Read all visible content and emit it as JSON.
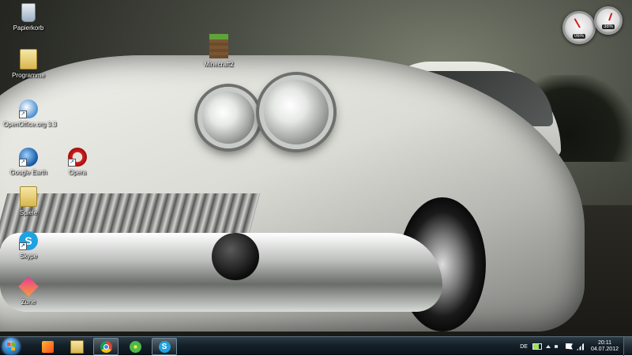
{
  "desktop": {
    "icons": [
      {
        "label": "Papierkorb",
        "icon": "recycle-bin-icon"
      },
      {
        "label": "Programme",
        "icon": "folder-icon"
      },
      {
        "label": "OpenOffice.org 3.3",
        "icon": "openoffice-icon"
      },
      {
        "label": "Google Earth",
        "icon": "google-earth-icon"
      },
      {
        "label": "Opera",
        "icon": "opera-icon"
      },
      {
        "label": "Spiele",
        "icon": "folder-icon"
      },
      {
        "label": "Skype",
        "icon": "skype-icon"
      },
      {
        "label": "Zune",
        "icon": "zune-icon"
      },
      {
        "label": "Minecraft2",
        "icon": "minecraft-icon"
      }
    ]
  },
  "gadget": {
    "cpu_readout": "06%",
    "memory_readout": "38%"
  },
  "taskbar": {
    "pinned": [
      {
        "name": "Windows Media Player",
        "icon": "media-player-icon",
        "active": false
      },
      {
        "name": "Windows Explorer",
        "icon": "explorer-folder-icon",
        "active": false
      },
      {
        "name": "Google Chrome",
        "icon": "chrome-icon",
        "active": true
      },
      {
        "name": "ICQ",
        "icon": "icq-icon",
        "active": false
      },
      {
        "name": "Skype",
        "icon": "skype-icon",
        "active": true
      }
    ],
    "tray": {
      "language": "DE",
      "time": "20:11",
      "date": "04.07.2012"
    }
  },
  "colors": {
    "taskbar": "#142029",
    "accent": "#3b8bd0"
  }
}
